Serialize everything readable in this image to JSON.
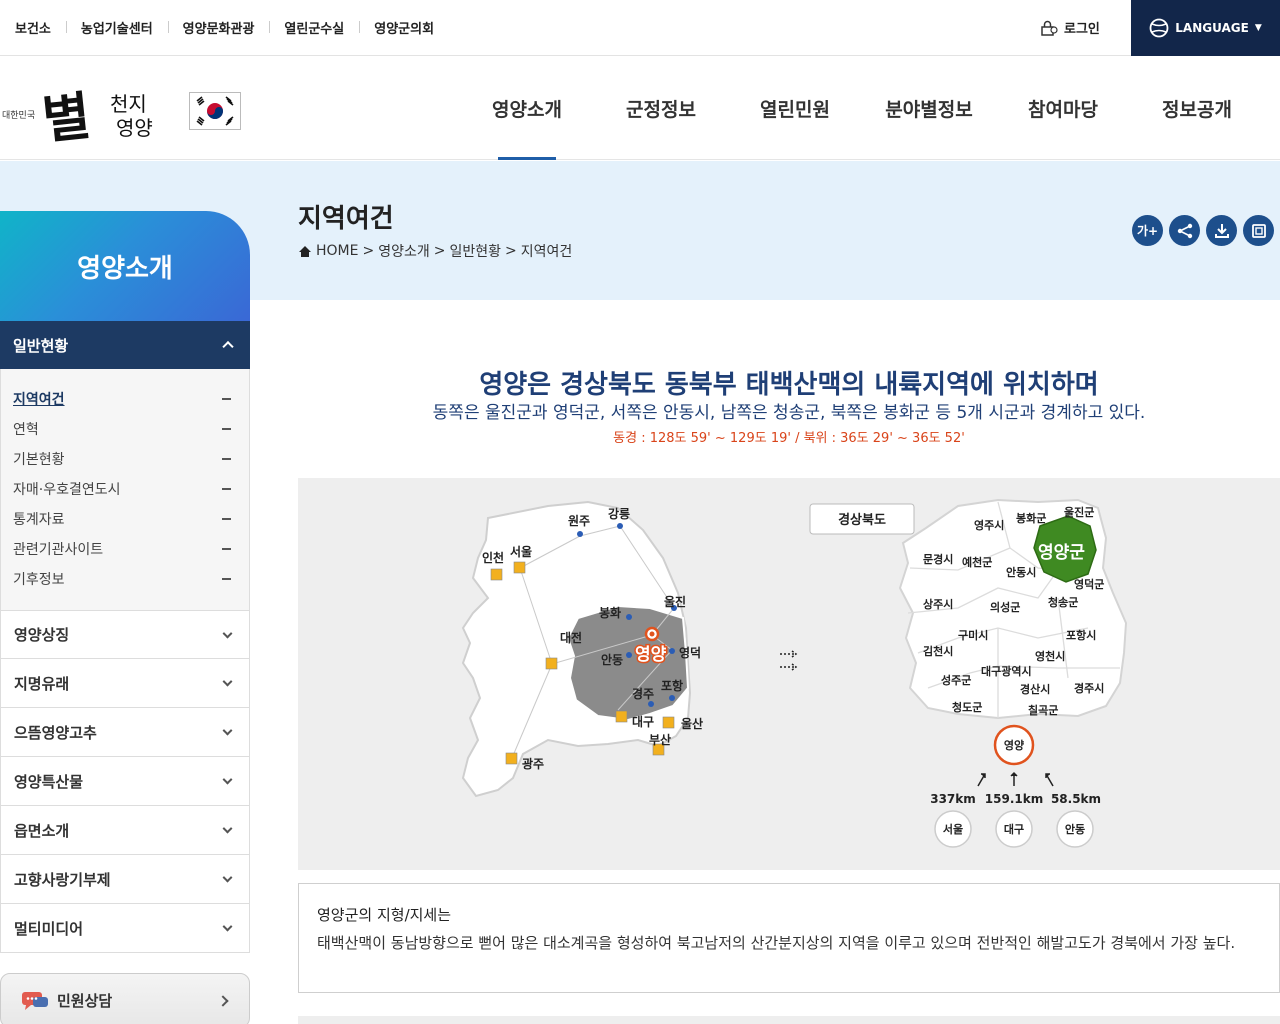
{
  "topbar": {
    "links": [
      "보건소",
      "농업기술센터",
      "영양문화관광",
      "열린군수실",
      "영양군의회"
    ],
    "login": "로그인",
    "language": "LANGUAGE"
  },
  "logo": {
    "small": "대한민국",
    "big": "별",
    "sub1": "천지",
    "sub2": "영양"
  },
  "gnb": [
    "영양소개",
    "군정정보",
    "열린민원",
    "분야별정보",
    "참여마당",
    "정보공개"
  ],
  "page": {
    "title": "지역여건",
    "breadcrumb": [
      "HOME",
      "영양소개",
      "일반현황",
      "지역여건"
    ],
    "tools": [
      "가+",
      "share",
      "download",
      "print"
    ]
  },
  "sidebar": {
    "title": "영양소개",
    "open_item": "일반현황",
    "sub_items": [
      "지역여건",
      "연혁",
      "기본현황",
      "자매·우호결연도시",
      "통계자료",
      "관련기관사이트",
      "기후정보"
    ],
    "items": [
      "영양상징",
      "지명유래",
      "으뜸영양고추",
      "영양특산물",
      "읍면소개",
      "고향사랑기부제",
      "멀티미디어"
    ],
    "civil": "민원상담"
  },
  "content": {
    "lead1": "영양은 경상북도 동북부 태백산맥의 내륙지역에 위치하며",
    "lead2": "동쪽은 울진군과 영덕군, 서쪽은 안동시, 남쪽은 청송군, 북쪽은 봉화군 등 5개 시군과 경계하고 있다.",
    "lead3": "동경 : 128도 59' ~ 129도 19' / 북위 : 36도 29' ~ 36도 52'",
    "korea_map": {
      "cities": [
        "원주",
        "강릉",
        "인천",
        "서울",
        "봉화",
        "울진",
        "대전",
        "안동",
        "영양",
        "영덕",
        "경주",
        "포항",
        "대구",
        "울산",
        "부산",
        "광주"
      ]
    },
    "gb_map": {
      "label": "경상북도",
      "regions": [
        "영주시",
        "봉화군",
        "울진군",
        "영양군",
        "문경시",
        "예천군",
        "안동시",
        "영덕군",
        "상주시",
        "의성군",
        "청송군",
        "구미시",
        "포항시",
        "김천시",
        "영천시",
        "대구광역시",
        "성주군",
        "경산시",
        "경주시",
        "청도군",
        "칠곡군"
      ]
    },
    "distances": {
      "center": "영양",
      "items": [
        {
          "km": "337km",
          "city": "서울"
        },
        {
          "km": "159.1km",
          "city": "대구"
        },
        {
          "km": "58.5km",
          "city": "안동"
        }
      ]
    },
    "terrain_title": "영양군의 지형/지세는",
    "terrain_text": "태백산맥이 동남방향으로 뻗어 많은 대소계곡을 형성하여 북고남저의 산간분지상의 지역을 이루고 있으며 전반적인 해발고도가 경북에서 가장 높다."
  }
}
